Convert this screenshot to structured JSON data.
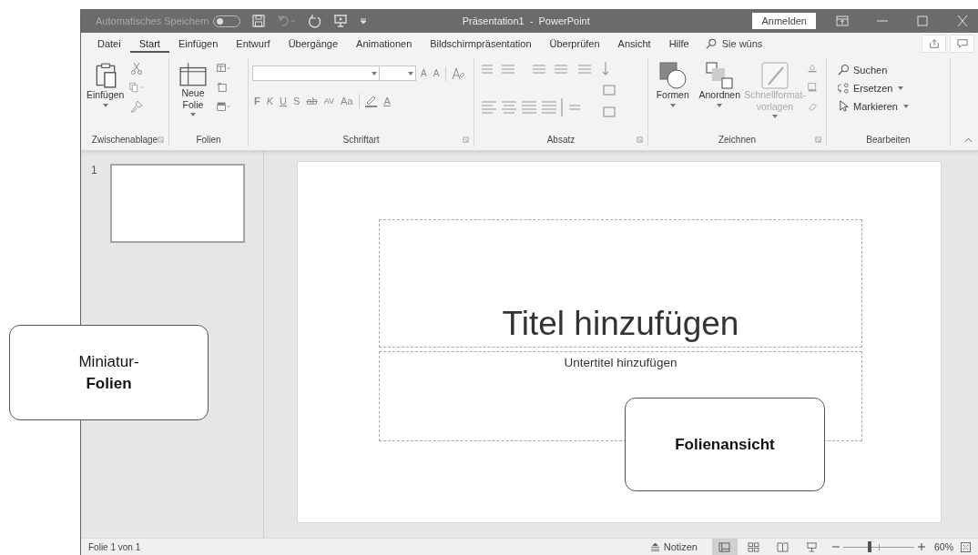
{
  "window": {
    "title": "Präsentation1  -  PowerPoint",
    "signin": "Anmelden"
  },
  "quick_access": {
    "autosave_label": "Automatisches Speichern",
    "autosave_on": false
  },
  "tabs": [
    {
      "label": "Datei",
      "selected": false
    },
    {
      "label": "Start",
      "selected": true
    },
    {
      "label": "Einfügen",
      "selected": false
    },
    {
      "label": "Entwurf",
      "selected": false
    },
    {
      "label": "Übergänge",
      "selected": false
    },
    {
      "label": "Animationen",
      "selected": false
    },
    {
      "label": "Bildschirmpräsentation",
      "selected": false
    },
    {
      "label": "Überprüfen",
      "selected": false
    },
    {
      "label": "Ansicht",
      "selected": false
    },
    {
      "label": "Hilfe",
      "selected": false
    }
  ],
  "tell_me": "Sie wüns",
  "ribbon": [
    {
      "kind": "clipboard",
      "label": "Zwischenablage",
      "launcher": true,
      "button": "Einfügen"
    },
    {
      "kind": "slides",
      "label": "Folien",
      "launcher": false,
      "button": "Neue Folie"
    },
    {
      "kind": "font",
      "label": "Schriftart",
      "launcher": true,
      "size_buttons": [
        "A",
        "A"
      ],
      "format_buttons": [
        {
          "label": "F",
          "kind": "bold"
        },
        {
          "label": "K",
          "kind": "italic"
        },
        {
          "label": "U",
          "kind": "underline"
        },
        {
          "label": "S",
          "kind": "shadow"
        },
        {
          "label": "ab",
          "kind": "strike"
        },
        {
          "label": "AV",
          "kind": "spacing"
        },
        {
          "label": "Aa",
          "kind": "case"
        },
        {
          "label": "A",
          "kind": "color"
        }
      ]
    },
    {
      "kind": "paragraph",
      "label": "Absatz",
      "launcher": true
    },
    {
      "kind": "drawing",
      "label": "Zeichnen",
      "launcher": true,
      "buttons": [
        {
          "label": "Formen",
          "disabled": false
        },
        {
          "label": "Anordnen",
          "disabled": false
        },
        {
          "label": "Schnellformat-vorlagen",
          "disabled": true
        }
      ]
    },
    {
      "kind": "editing",
      "label": "Bearbeiten",
      "launcher": false,
      "buttons": [
        {
          "label": "Suchen",
          "kind": "search"
        },
        {
          "label": "Ersetzen",
          "kind": "replace"
        },
        {
          "label": "Markieren",
          "kind": "select"
        }
      ]
    }
  ],
  "slides": [
    {
      "number": "1",
      "selected": true
    }
  ],
  "slide": {
    "title_placeholder": "Titel hinzufügen",
    "subtitle_placeholder": "Untertitel hinzufügen"
  },
  "status_bar": {
    "slide_info": "Folie 1 von 1",
    "notes": "Notizen",
    "views": [
      {
        "kind": "normal",
        "selected": true
      },
      {
        "kind": "sorter",
        "selected": false
      },
      {
        "kind": "reading",
        "selected": false
      },
      {
        "kind": "show",
        "selected": false
      }
    ],
    "zoom": {
      "level": 0.37,
      "reading": "60%"
    }
  },
  "callouts": [
    {
      "kind": "thumbnails",
      "lines": [
        "Miniatur-",
        "**Folien**"
      ]
    },
    {
      "kind": "slideview",
      "lines": [
        "**Folienansicht**"
      ]
    }
  ]
}
